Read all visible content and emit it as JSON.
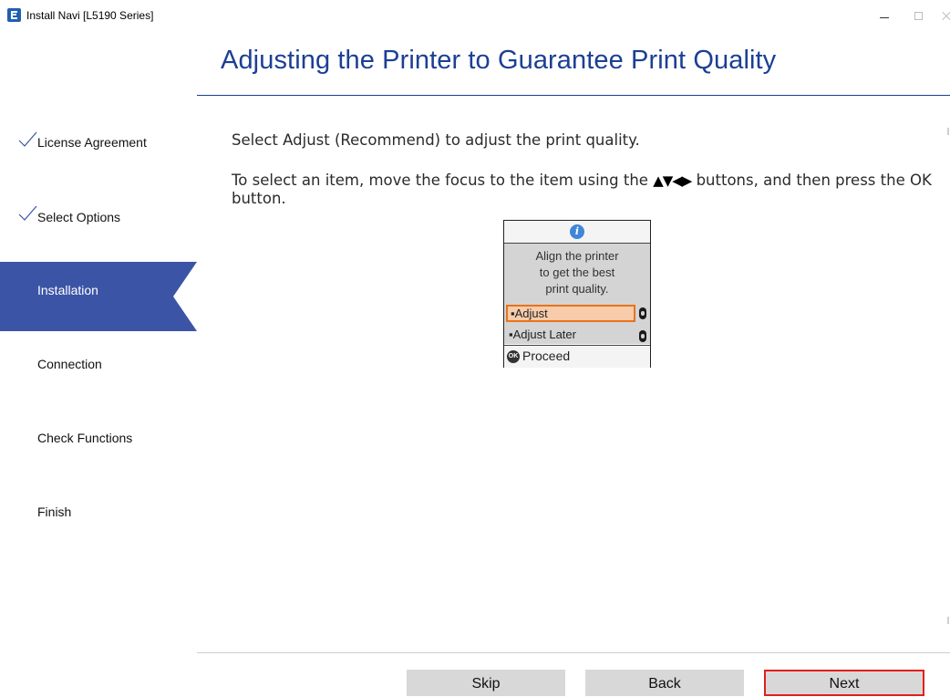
{
  "window": {
    "title": "Install Navi [L5190 Series]",
    "minimize_glyph": "",
    "maximize_glyph": "",
    "close_glyph": ""
  },
  "page": {
    "title": "Adjusting the Printer to Guarantee Print Quality"
  },
  "sidebar": {
    "items": [
      {
        "label": "License Agreement",
        "state": "done"
      },
      {
        "label": "Select Options",
        "state": "done"
      },
      {
        "label": "Installation",
        "state": "active"
      },
      {
        "label": "Connection",
        "state": "pending"
      },
      {
        "label": "Check Functions",
        "state": "pending"
      },
      {
        "label": "Finish",
        "state": "pending"
      }
    ]
  },
  "content": {
    "line1": "Select Adjust (Recommend) to adjust the print quality.",
    "line2_pre": "To select an item, move the focus to the item using the ",
    "line2_arrows": "▲▼◀▶",
    "line2_post": " buttons, and then press the OK button."
  },
  "lcd": {
    "info_icon": "i",
    "message": [
      "Align the printer",
      "to get the best",
      "print quality."
    ],
    "options": [
      {
        "label": "Adjust",
        "selected": true
      },
      {
        "label": "Adjust Later",
        "selected": false
      }
    ],
    "ok_icon": "OK",
    "proceed": "Proceed"
  },
  "footer": {
    "skip_label": "Skip",
    "back_label": "Back",
    "next_label": "Next"
  },
  "colors": {
    "accent": "#3b54a6",
    "title": "#1c3f94",
    "highlight_border": "#e0201a",
    "lcd_selected": "#f8ccaa"
  }
}
